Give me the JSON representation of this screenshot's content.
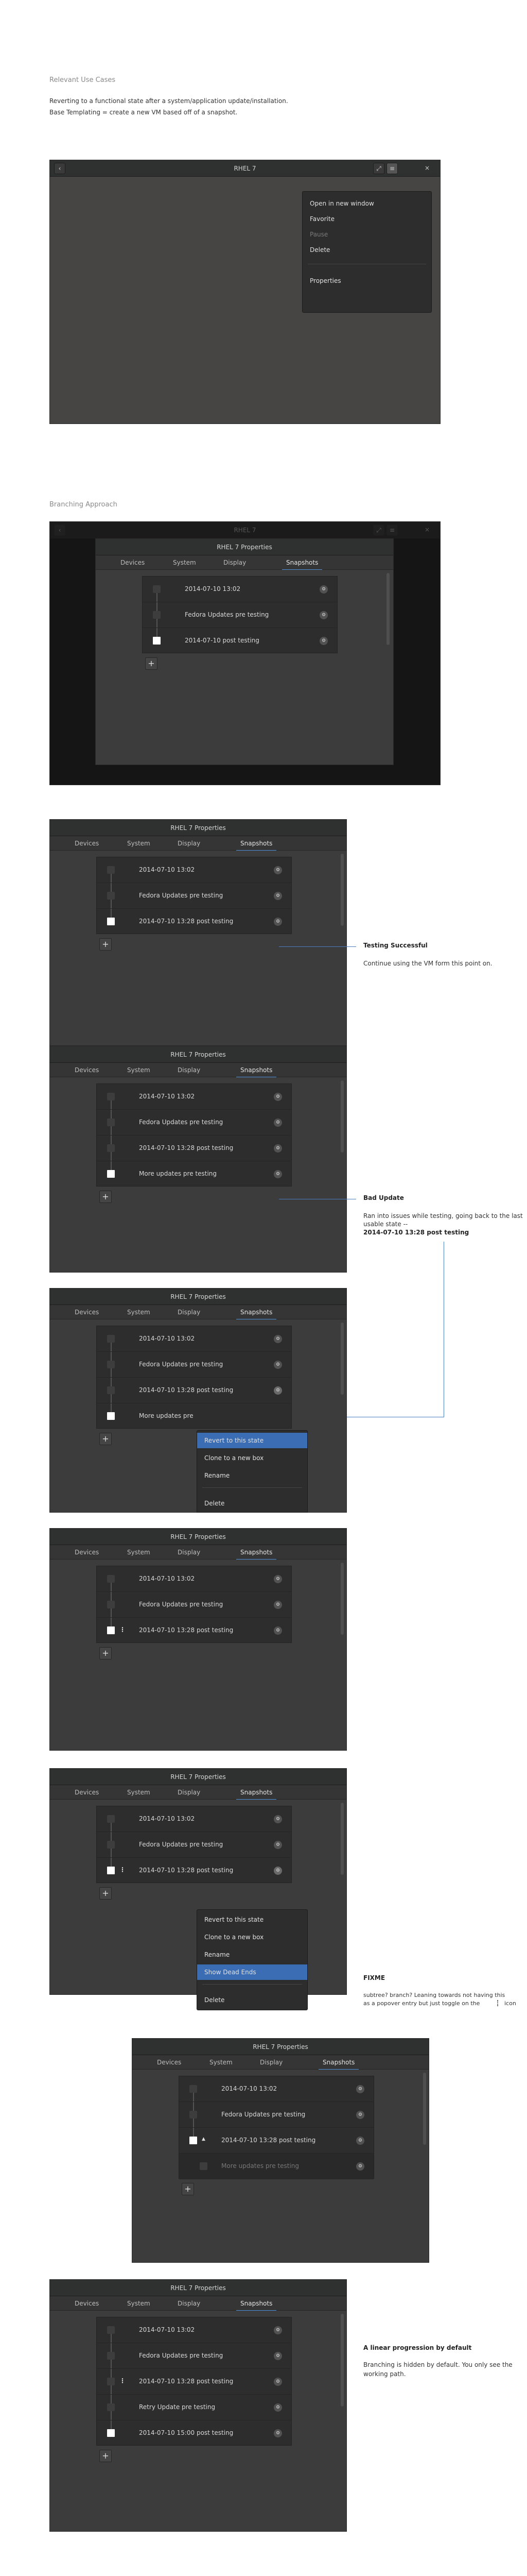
{
  "sec1": {
    "heading": "Relevant Use Cases",
    "line1": "Reverting to a functional state after a system/application update/installation.",
    "line2": "Base Templating = create a new VM based off of a snapshot."
  },
  "win1": {
    "title": "RHEL 7",
    "menu": [
      "Open in new window",
      "Favorite",
      "Pause",
      "Delete",
      "Properties"
    ]
  },
  "sec2": {
    "heading": "Branching Approach"
  },
  "dialog": {
    "title": "RHEL 7 Properties",
    "tabs": [
      "Devices",
      "System",
      "Display",
      "Snapshots"
    ]
  },
  "snap": {
    "s1": "2014-07-10 13:02",
    "s2": "Fedora Updates pre testing",
    "s3": "2014-07-10 post testing",
    "s3b": "2014-07-10 13:28 post testing",
    "s4": "More updates pre testing",
    "s4b": "More updates pre",
    "s5": "Retry Update pre testing",
    "s6": "2014-07-10 15:00 post testing"
  },
  "ctx1": [
    "Revert to this state",
    "Clone to a new box",
    "Rename",
    "Delete"
  ],
  "ctx2": [
    "Revert to this state",
    "Clone to a new box",
    "Rename",
    "Show Dead Ends",
    "Delete"
  ],
  "notes": {
    "n1t": "Testing Successful",
    "n1p": "Continue using the VM form this point on.",
    "n2t": "Bad Update",
    "n2p1": "Ran into issues while testing, going back to the last",
    "n2p2": "usable state --",
    "n2p3": "2014-07-10 13:28 post testing",
    "n3t": "FIXME",
    "n3p1": "subtree? branch? Leaning towards not having this",
    "n3p2": "as a popover entry but just toggle on the",
    "n3p3": "icon",
    "n4t": "A linear progression by default",
    "n4p1": "Branching is hidden by default. You only see the",
    "n4p2": "working path."
  }
}
